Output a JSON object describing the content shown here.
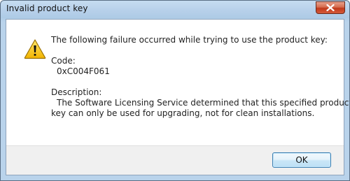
{
  "window": {
    "title": "Invalid product key"
  },
  "message": {
    "intro": "The following failure occurred while trying to use the product key:",
    "code_label": "Code:",
    "code_value": "0xC004F061",
    "description_label": "Description:",
    "description_line1": "The Software Licensing Service determined that this specified product",
    "description_line2": "key can only be used for upgrading, not for clean installations."
  },
  "buttons": {
    "ok_label": "OK"
  },
  "icons": {
    "dialog_icon": "warning-icon",
    "close_icon": "close-icon"
  },
  "colors": {
    "title_bar": "#b7d0ea",
    "close_button": "#c0391b",
    "warning_fill": "#f5c200"
  }
}
